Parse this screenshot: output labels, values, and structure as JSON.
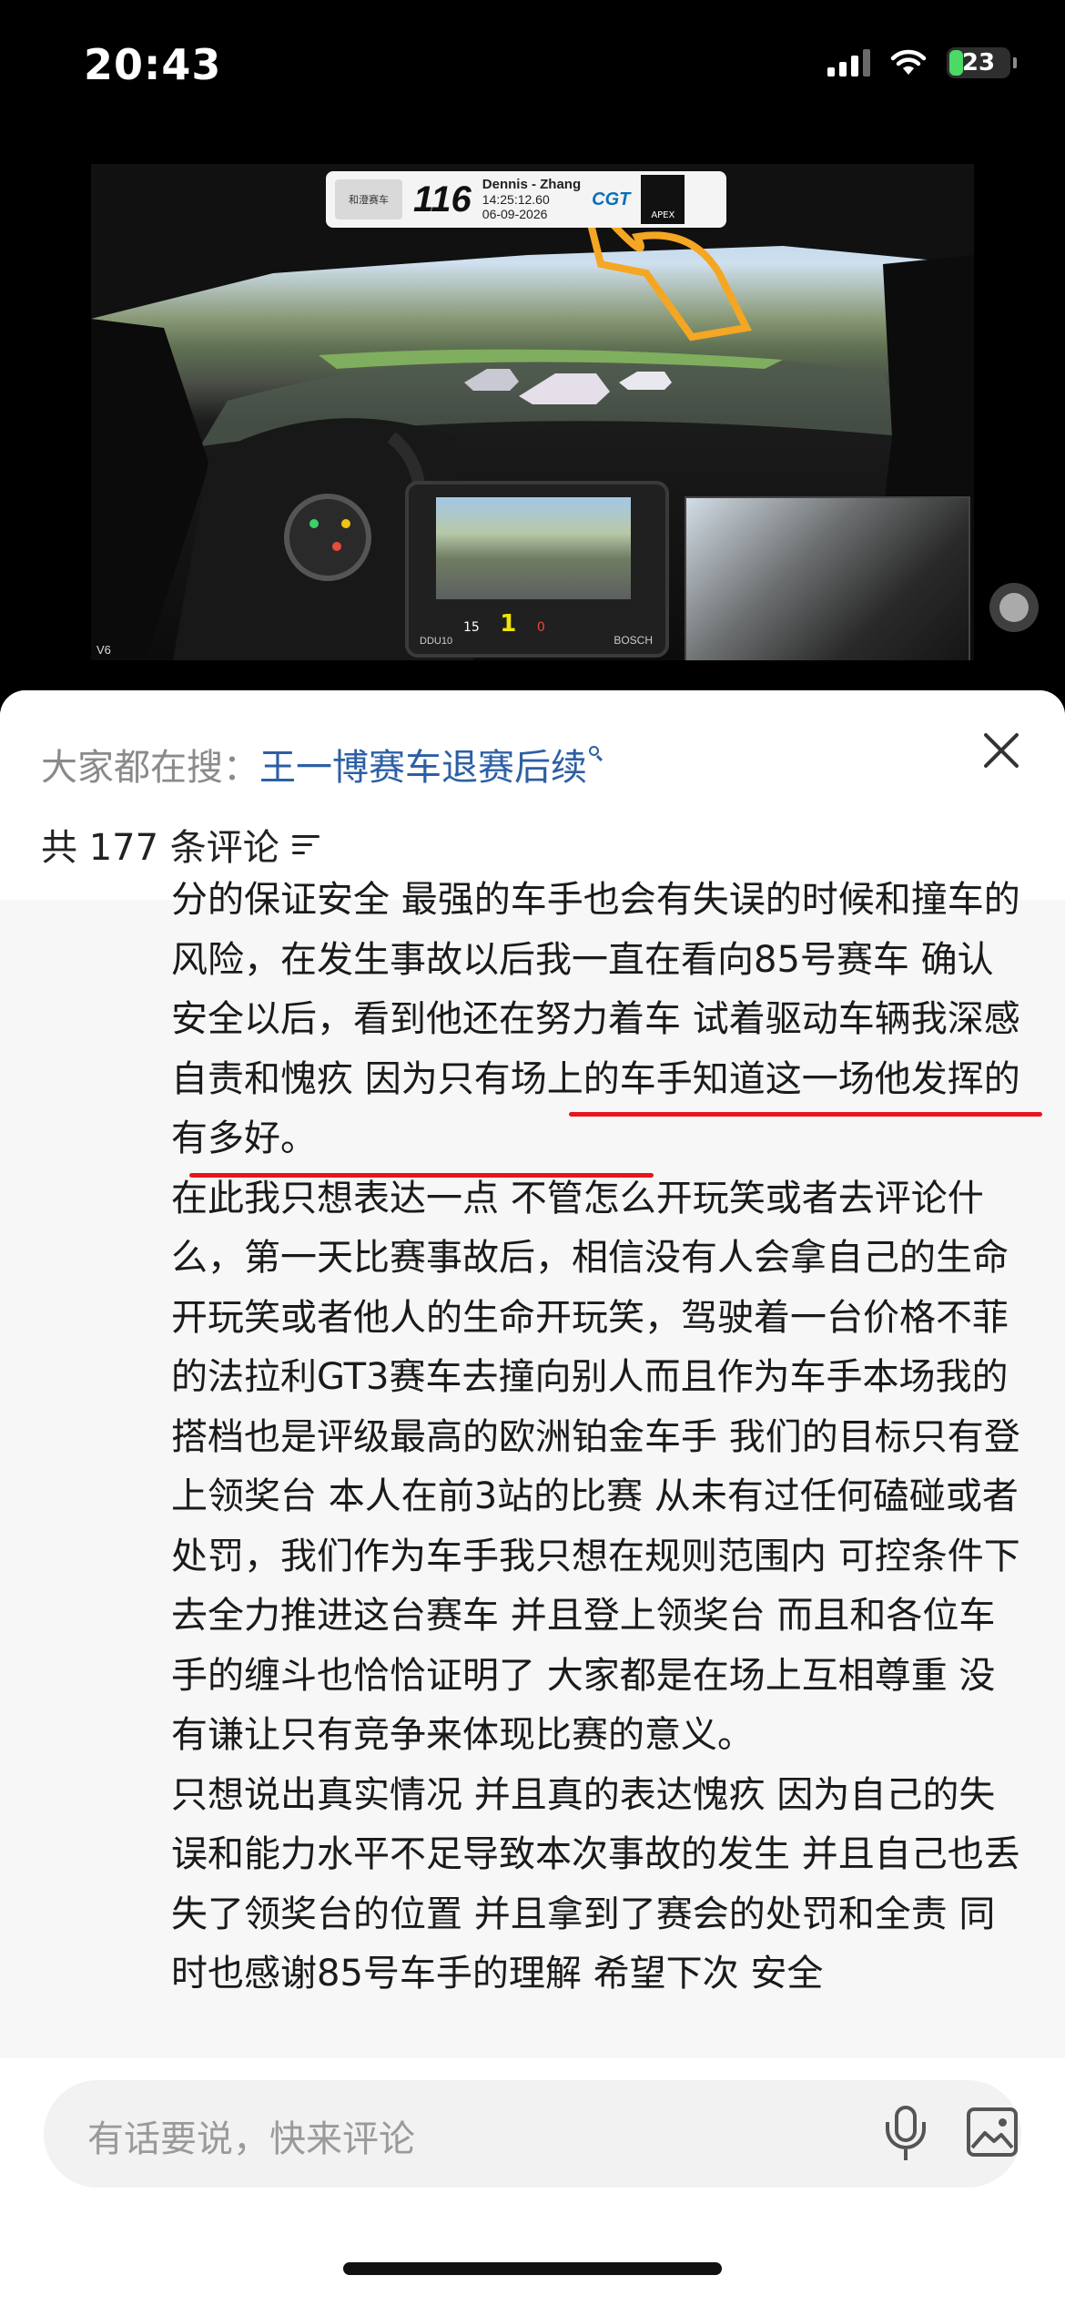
{
  "status_bar": {
    "time": "20:43",
    "battery": "23",
    "battery_level": 0.23,
    "battery_color": "#4cd964"
  },
  "video": {
    "overlay": {
      "team_logo_text": "和澄赛车",
      "car_number": "116",
      "drivers": "Dennis - Zhang",
      "lap_time": "14:25:12.60",
      "date": "06-09-2026",
      "series_logo": "CGT",
      "apex_logo": "APEX"
    },
    "dash": {
      "gear": "1",
      "speed_left": "15",
      "speed_right": "0",
      "brand": "BOSCH",
      "model": "DDU10"
    },
    "corner_label": "V6"
  },
  "sheet": {
    "hot_search_label": "大家都在搜：",
    "hot_search_link": "王一博赛车退赛后续",
    "comment_count": "共 177 条评论",
    "accent_color": "#2c5fa5",
    "underline_color": "#e8161c"
  },
  "comment": {
    "paragraphs": [
      "分的保证安全 最强的车手也会有失误的时候和撞车的风险，在发生事故以后我一直在看向85号赛车 确认安全以后，看到他还在努力着车 试着驱动车辆我深感自责和愧疚 因为只有场上的车手知道这一场他发挥的有多好。",
      "在此我只想表达一点 不管怎么开玩笑或者去评论什么，第一天比赛事故后，相信没有人会拿自己的生命开玩笑或者他人的生命开玩笑，驾驶着一台价格不菲的法拉利GT3赛车去撞向别人而且作为车手本场我的搭档也是评级最高的欧洲铂金车手 我们的目标只有登上领奖台 本人在前3站的比赛 从未有过任何磕碰或者处罚，我们作为车手我只想在规则范围内 可控条件下 去全力推进这台赛车 并且登上领奖台 而且和各位车手的缠斗也恰恰证明了 大家都是在场上互相尊重 没有谦让只有竞争来体现比赛的意义。",
      "只想说出真实情况 并且真的表达愧疚 因为自己的失误和能力水平不足导致本次事故的发生 并且自己也丢失了领奖台的位置 并且拿到了赛会的处罚和全责 同时也感谢85号车手的理解 希望下次 安全"
    ]
  },
  "bottom_bar": {
    "input_placeholder": "有话要说，快来评论"
  }
}
